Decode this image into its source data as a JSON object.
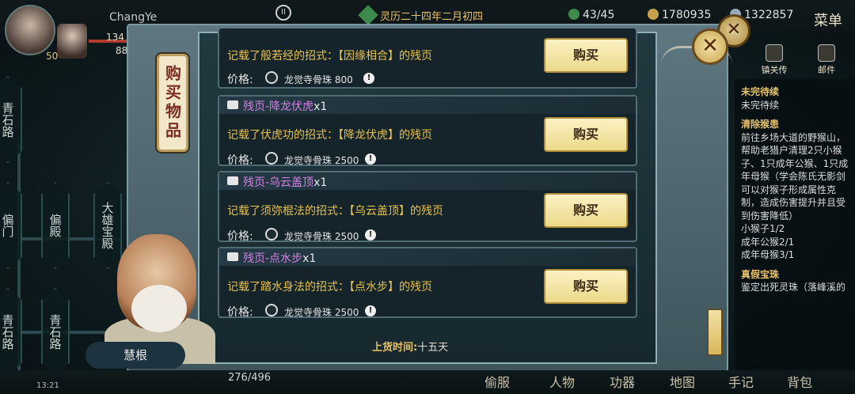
{
  "player": {
    "name": "ChangYe",
    "level": "50",
    "hp": "134",
    "mp": "88"
  },
  "header": {
    "date": "灵历二十四年二月初四",
    "stamina": "43/45",
    "coins": "1780935",
    "gems": "1322857",
    "menu": "菜单"
  },
  "map": {
    "nodes": [
      "青石路",
      "偏门",
      "偏殿",
      "大雄宝殿",
      "青石路",
      "青石路"
    ]
  },
  "shop": {
    "tab_label": "购买物品",
    "top_partial": {
      "desc": "记载了般若经的招式：【因缘相合】的残页",
      "price_label": "价格:",
      "currency": "龙觉寺骨珠",
      "price": "800",
      "buy_label": "购买"
    },
    "items": [
      {
        "name": "残页-降龙伏虎",
        "qty": "x1",
        "desc": "记载了伏虎功的招式：【降龙伏虎】的残页",
        "price_label": "价格:",
        "currency": "龙觉寺骨珠",
        "price": "2500",
        "buy_label": "购买"
      },
      {
        "name": "残页-乌云盖顶",
        "qty": "x1",
        "desc": "记载了须弥棍法的招式：【乌云盖顶】的残页",
        "price_label": "价格:",
        "currency": "龙觉寺骨珠",
        "price": "2500",
        "buy_label": "购买"
      },
      {
        "name": "残页-点水步",
        "qty": "x1",
        "desc": "记载了踏水身法的招式：【点水步】的残页",
        "price_label": "价格:",
        "currency": "龙觉寺骨珠",
        "price": "2500",
        "buy_label": "购买"
      }
    ],
    "restock_label": "上货时间:",
    "restock_value": "十五天"
  },
  "npc": {
    "name": "慧根"
  },
  "quests": [
    {
      "title": "未完待续",
      "lines": [
        "未完待续"
      ]
    },
    {
      "title": "清除猴患",
      "lines": [
        "前往乡场大道的野猴山，帮助老猎户清理2只小猴子、1只成年公猴、1只成年母猴（学会陈氏无影剑可以对猴子形成属性克制，造成伤害提升并且受到伤害降低）",
        "小猴子1/2",
        "成年公猴2/1",
        "成年母猴3/1"
      ]
    },
    {
      "title": "真假宝珠",
      "lines": [
        "鉴定出死灵珠（落峰溪的"
      ]
    }
  ],
  "top_right_icons": [
    "镇关传",
    "邮件"
  ],
  "bottom": {
    "time": "13:21",
    "bag_count": "276/496",
    "nav": [
      "偷服",
      "人物",
      "功器",
      "地图",
      "手记",
      "背包"
    ]
  }
}
